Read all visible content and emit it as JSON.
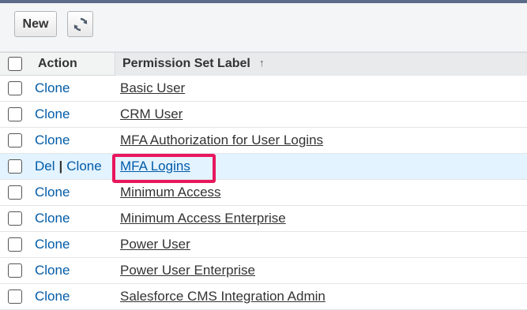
{
  "toolbar": {
    "new_label": "New",
    "refresh_icon": "refresh-icon"
  },
  "table": {
    "columns": {
      "action": "Action",
      "label": "Permission Set Label",
      "sort_indicator": "↑"
    },
    "rows": [
      {
        "actions": [
          "Clone"
        ],
        "label": "Basic User"
      },
      {
        "actions": [
          "Clone"
        ],
        "label": "CRM User"
      },
      {
        "actions": [
          "Clone"
        ],
        "label": "MFA Authorization for User Logins"
      },
      {
        "actions": [
          "Del",
          "Clone"
        ],
        "action_separator": "|",
        "label": "MFA Logins",
        "highlighted": true
      },
      {
        "actions": [
          "Clone"
        ],
        "label": "Minimum Access"
      },
      {
        "actions": [
          "Clone"
        ],
        "label": "Minimum Access Enterprise"
      },
      {
        "actions": [
          "Clone"
        ],
        "label": "Power User"
      },
      {
        "actions": [
          "Clone"
        ],
        "label": "Power User Enterprise"
      },
      {
        "actions": [
          "Clone"
        ],
        "label": "Salesforce CMS Integration Admin"
      }
    ]
  },
  "colors": {
    "link": "#015ba7",
    "highlight_row": "#e3f3ff",
    "annotation_border": "#e8175d",
    "top_bar": "#5b6b89"
  }
}
